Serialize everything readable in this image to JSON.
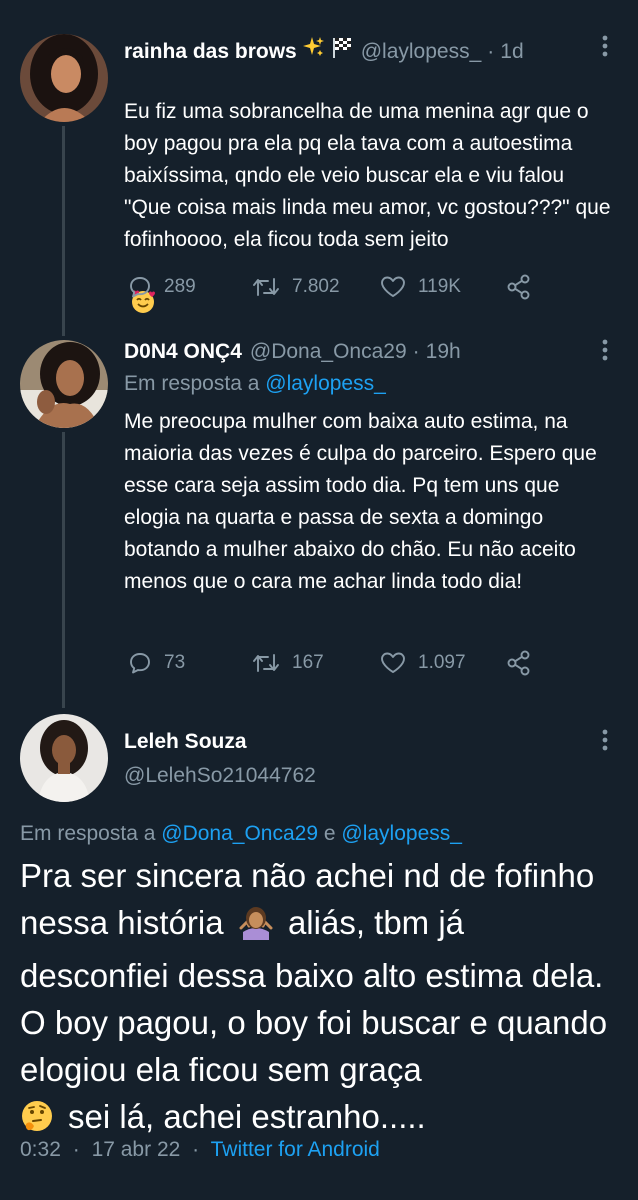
{
  "tweets": [
    {
      "name": "rainha das brows",
      "handle": "@laylopess_",
      "time": "1d",
      "text": "Eu fiz uma sobrancelha de uma menina agr que o boy pagou pra ela pq ela tava com a autoestima baixíssima, qndo ele veio buscar ela e viu falou \"Que coisa mais linda meu amor, vc gostou???\" que fofinhoooo, ela ficou toda sem jeito",
      "replies": "289",
      "retweets": "7.802",
      "likes": "119K"
    },
    {
      "name": "D0N4 ONÇ4",
      "handle": "@Dona_Onca29",
      "time": "19h",
      "replying_prefix": "Em resposta a",
      "replying_to": "@laylopess_",
      "text": "Me preocupa mulher com baixa auto estima, na maioria das vezes é culpa do parceiro. Espero que esse cara seja assim todo dia. Pq tem uns que elogia na quarta e passa de sexta a domingo botando a mulher abaixo do chão. Eu não aceito menos que o cara me achar linda todo dia!",
      "replies": "73",
      "retweets": "167",
      "likes": "1.097"
    }
  ],
  "main_tweet": {
    "name": "Leleh Souza",
    "handle": "@LelehSo21044762",
    "replying_prefix": "Em resposta a",
    "replying_to_1": "@Dona_Onca29",
    "replying_and": "e",
    "replying_to_2": "@laylopess_",
    "text_1": "Pra ser sincera não achei nd de fofinho nessa história",
    "text_2": "aliás, tbm já desconfiei dessa baixo alto estima dela. O boy pagou, o boy foi buscar e quando elogiou ela ficou sem graça",
    "text_3": "sei lá, achei estranho.....",
    "time": "0:32",
    "date": "17 abr 22",
    "source": "Twitter for Android"
  },
  "colors": {
    "background": "#15202b",
    "secondary_text": "#8899a6",
    "link": "#1da1f2"
  },
  "icons": [
    "reply-icon",
    "retweet-icon",
    "like-icon",
    "share-icon",
    "more-icon",
    "sparkles-emoji",
    "checkered-flag-emoji",
    "smiling-face-with-hearts-emoji",
    "person-shrugging-emoji",
    "thinking-face-emoji"
  ]
}
